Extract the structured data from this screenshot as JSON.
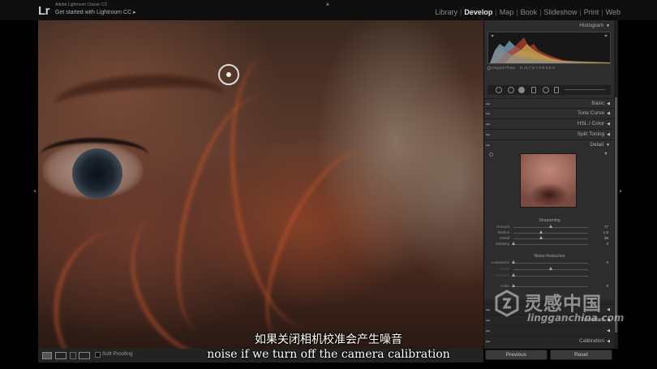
{
  "app": {
    "logo": "Lr",
    "title": "Adobe Lightroom Classic CC",
    "get_started": "Get started with Lightroom CC",
    "get_started_arrow": "▸"
  },
  "modules": {
    "items": [
      "Library",
      "Develop",
      "Map",
      "Book",
      "Slideshow",
      "Print",
      "Web"
    ],
    "active": "Develop",
    "separator": "|"
  },
  "histogram": {
    "header": "Histogram",
    "original_photo_label": "Original Photo",
    "readout": "R  10,7  G  7,9  B  6,8 %"
  },
  "panels": {
    "basic": "Basic",
    "tone_curve": "Tone Curve",
    "hsl": "HSL / Color",
    "split_toning": "Split Toning",
    "detail": "Detail",
    "transform": "Transform",
    "calibration": "Calibration",
    "effects_partial": "Effects"
  },
  "sharpening": {
    "title": "Sharpening",
    "amount_label": "Amount",
    "amount_value": "77",
    "amount_level": 0.51,
    "radius_label": "Radius",
    "radius_value": "1.5",
    "radius_level": 0.37,
    "detail_label": "Detail",
    "detail_value": "38",
    "detail_level": 0.38,
    "masking_label": "Masking",
    "masking_value": "0",
    "masking_level": 0
  },
  "noise_reduction": {
    "title": "Noise Reduction",
    "luminance_label": "Luminance",
    "luminance_value": "0",
    "luminance_level": 0,
    "detail_label": "Detail",
    "detail_value": "",
    "detail_level": 0.5,
    "contrast_label": "Contrast",
    "contrast_value": "",
    "contrast_level": 0,
    "color_label": "Color",
    "color_value": "0",
    "color_level": 0
  },
  "toolbar": {
    "soft_proofing_label": "Soft Proofing"
  },
  "buttons": {
    "previous": "Previous",
    "reset": "Reset"
  },
  "subtitles": {
    "cn": "如果关闭相机校准会产生噪音",
    "en": "noise if we turn off the camera calibration"
  },
  "watermark": {
    "cn": "灵感中国",
    "en": "lingganchina.com"
  },
  "icons": {
    "left_panel_arrow": "◂",
    "right_panel_arrow": "▸",
    "collapse_triangle": "▼",
    "expand_triangle": "◀"
  }
}
